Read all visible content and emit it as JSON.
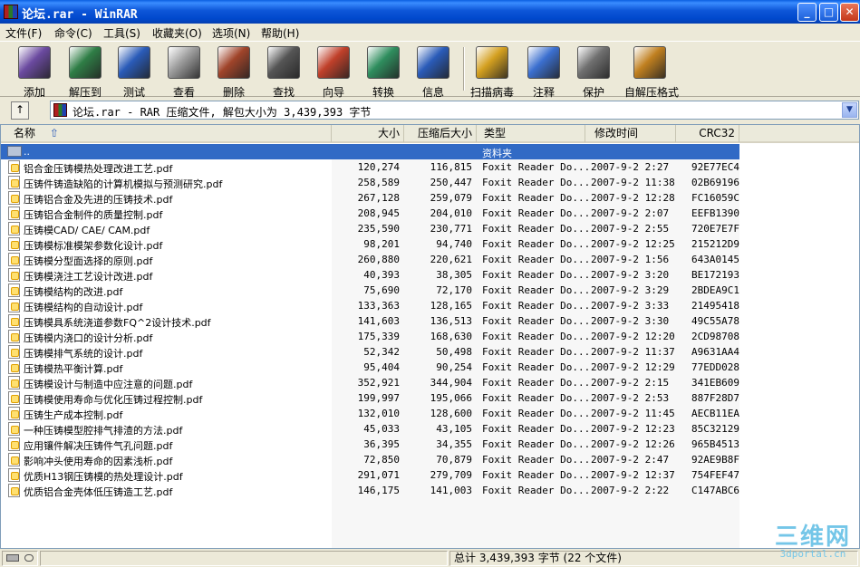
{
  "window": {
    "title": "论坛.rar - WinRAR",
    "minimize": "_",
    "maximize": "□",
    "close": "✕"
  },
  "menu": [
    "文件(F)",
    "命令(C)",
    "工具(S)",
    "收藏夹(O)",
    "选项(N)",
    "帮助(H)"
  ],
  "toolbar": [
    {
      "label": "添加",
      "icon": "add-archive-icon",
      "color": "#6b4aa0"
    },
    {
      "label": "解压到",
      "icon": "extract-to-icon",
      "color": "#2f7e46"
    },
    {
      "label": "测试",
      "icon": "test-icon",
      "color": "#2a5bb8"
    },
    {
      "label": "查看",
      "icon": "view-icon",
      "color": "#9c9c9c"
    },
    {
      "label": "删除",
      "icon": "delete-icon",
      "color": "#a0442a"
    },
    {
      "label": "查找",
      "icon": "find-icon",
      "color": "#555555"
    },
    {
      "label": "向导",
      "icon": "wizard-icon",
      "color": "#c0402a"
    },
    {
      "label": "转换",
      "icon": "convert-icon",
      "color": "#2f8e5e"
    },
    {
      "label": "信息",
      "icon": "info-icon",
      "color": "#2a5bb8"
    },
    {
      "label": "扫描病毒",
      "icon": "scan-virus-icon",
      "color": "#d4a020"
    },
    {
      "label": "注释",
      "icon": "comment-icon",
      "color": "#3b6fcf"
    },
    {
      "label": "保护",
      "icon": "protect-icon",
      "color": "#707070"
    },
    {
      "label": "自解压格式",
      "icon": "sfx-icon",
      "color": "#c08020"
    }
  ],
  "address": {
    "text": "论坛.rar - RAR 压缩文件, 解包大小为 3,439,393 字节",
    "up": "↑"
  },
  "columns": {
    "name": "名称",
    "size": "大小",
    "packed": "压缩后大小",
    "type": "类型",
    "modified": "修改时间",
    "crc": "CRC32"
  },
  "sort_arrow": "⇧",
  "folder_row": {
    "name": "..",
    "type": "资料夹"
  },
  "files": [
    {
      "name": "铝合金压铸模热处理改进工艺.pdf",
      "size": "120,274",
      "packed": "116,815",
      "type": "Foxit Reader Do...",
      "modified": "2007-9-2 2:27",
      "crc": "92E77EC4"
    },
    {
      "name": "压铸件铸造缺陷的计算机模拟与预测研究.pdf",
      "size": "258,589",
      "packed": "250,447",
      "type": "Foxit Reader Do...",
      "modified": "2007-9-2 11:38",
      "crc": "02B69196"
    },
    {
      "name": "压铸铝合金及先进的压铸技术.pdf",
      "size": "267,128",
      "packed": "259,079",
      "type": "Foxit Reader Do...",
      "modified": "2007-9-2 12:28",
      "crc": "FC16059C"
    },
    {
      "name": "压铸铝合金制件的质量控制.pdf",
      "size": "208,945",
      "packed": "204,010",
      "type": "Foxit Reader Do...",
      "modified": "2007-9-2 2:07",
      "crc": "EEFB1390"
    },
    {
      "name": "压铸模CAD/ CAE/ CAM.pdf",
      "size": "235,590",
      "packed": "230,771",
      "type": "Foxit Reader Do...",
      "modified": "2007-9-2 2:55",
      "crc": "720E7E7F"
    },
    {
      "name": "压铸模标准模架参数化设计.pdf",
      "size": "98,201",
      "packed": "94,740",
      "type": "Foxit Reader Do...",
      "modified": "2007-9-2 12:25",
      "crc": "215212D9"
    },
    {
      "name": "压铸模分型面选择的原则.pdf",
      "size": "260,880",
      "packed": "220,621",
      "type": "Foxit Reader Do...",
      "modified": "2007-9-2 1:56",
      "crc": "643A0145"
    },
    {
      "name": "压铸模浇注工艺设计改进.pdf",
      "size": "40,393",
      "packed": "38,305",
      "type": "Foxit Reader Do...",
      "modified": "2007-9-2 3:20",
      "crc": "BE172193"
    },
    {
      "name": "压铸模结构的改进.pdf",
      "size": "75,690",
      "packed": "72,170",
      "type": "Foxit Reader Do...",
      "modified": "2007-9-2 3:29",
      "crc": "2BDEA9C1"
    },
    {
      "name": "压铸模结构的自动设计.pdf",
      "size": "133,363",
      "packed": "128,165",
      "type": "Foxit Reader Do...",
      "modified": "2007-9-2 3:33",
      "crc": "21495418"
    },
    {
      "name": "压铸模具系统浇道参数FQ^2设计技术.pdf",
      "size": "141,603",
      "packed": "136,513",
      "type": "Foxit Reader Do...",
      "modified": "2007-9-2 3:30",
      "crc": "49C55A78"
    },
    {
      "name": "压铸模内浇口的设计分析.pdf",
      "size": "175,339",
      "packed": "168,630",
      "type": "Foxit Reader Do...",
      "modified": "2007-9-2 12:20",
      "crc": "2CD98708"
    },
    {
      "name": "压铸模排气系统的设计.pdf",
      "size": "52,342",
      "packed": "50,498",
      "type": "Foxit Reader Do...",
      "modified": "2007-9-2 11:37",
      "crc": "A9631AA4"
    },
    {
      "name": "压铸模热平衡计算.pdf",
      "size": "95,404",
      "packed": "90,254",
      "type": "Foxit Reader Do...",
      "modified": "2007-9-2 12:29",
      "crc": "77EDD028"
    },
    {
      "name": "压铸模设计与制造中应注意的问题.pdf",
      "size": "352,921",
      "packed": "344,904",
      "type": "Foxit Reader Do...",
      "modified": "2007-9-2 2:15",
      "crc": "341EB609"
    },
    {
      "name": "压铸模使用寿命与优化压铸过程控制.pdf",
      "size": "199,997",
      "packed": "195,066",
      "type": "Foxit Reader Do...",
      "modified": "2007-9-2 2:53",
      "crc": "887F28D7"
    },
    {
      "name": "压铸生产成本控制.pdf",
      "size": "132,010",
      "packed": "128,600",
      "type": "Foxit Reader Do...",
      "modified": "2007-9-2 11:45",
      "crc": "AECB11EA"
    },
    {
      "name": "一种压铸模型腔排气排渣的方法.pdf",
      "size": "45,033",
      "packed": "43,105",
      "type": "Foxit Reader Do...",
      "modified": "2007-9-2 12:23",
      "crc": "85C32129"
    },
    {
      "name": "应用镶件解决压铸件气孔问题.pdf",
      "size": "36,395",
      "packed": "34,355",
      "type": "Foxit Reader Do...",
      "modified": "2007-9-2 12:26",
      "crc": "965B4513"
    },
    {
      "name": "影响冲头使用寿命的因素浅析.pdf",
      "size": "72,850",
      "packed": "70,879",
      "type": "Foxit Reader Do...",
      "modified": "2007-9-2 2:47",
      "crc": "92AE9B8F"
    },
    {
      "name": "优质H13钢压铸模的热处理设计.pdf",
      "size": "291,071",
      "packed": "279,709",
      "type": "Foxit Reader Do...",
      "modified": "2007-9-2 12:37",
      "crc": "754FEF47"
    },
    {
      "name": "优质铝合金壳体低压铸造工艺.pdf",
      "size": "146,175",
      "packed": "141,003",
      "type": "Foxit Reader Do...",
      "modified": "2007-9-2 2:22",
      "crc": "C147ABC6"
    }
  ],
  "status": {
    "total": "总计 3,439,393 字节 (22 个文件)"
  },
  "watermark": {
    "big": "三维网",
    "small": "3dportal.cn"
  }
}
